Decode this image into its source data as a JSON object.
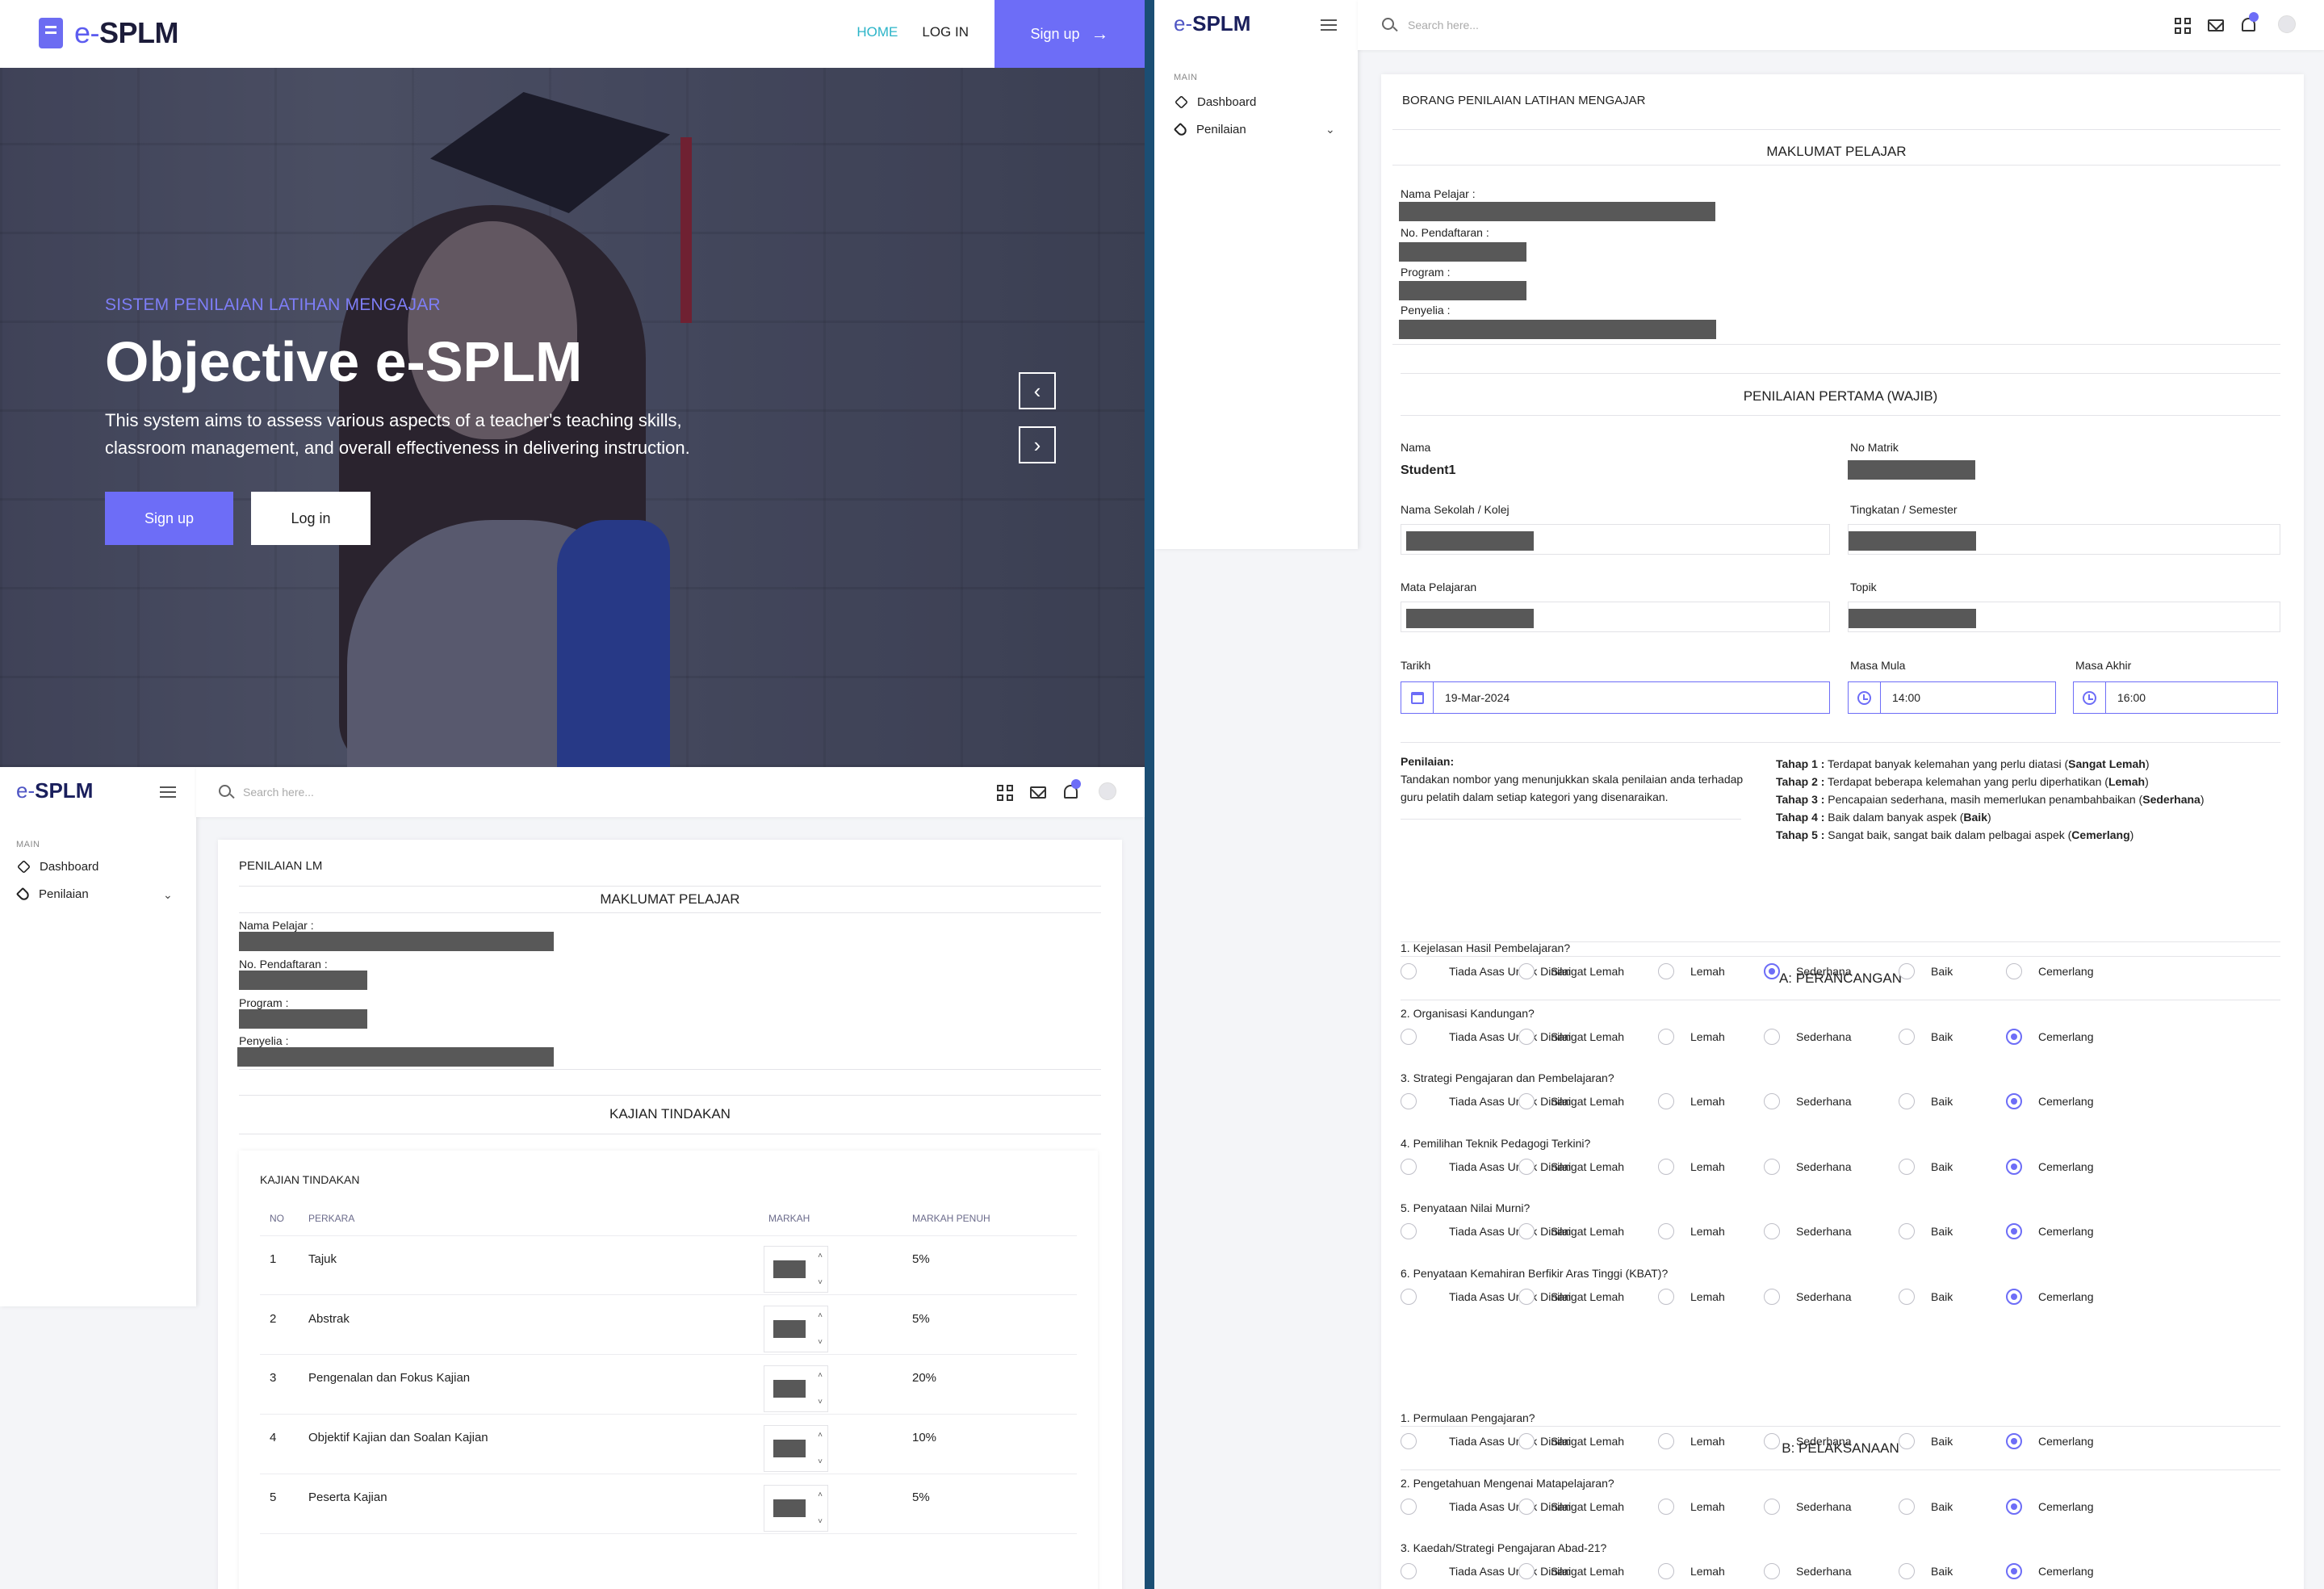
{
  "landing": {
    "brand": "e-SPLM",
    "brand_e": "e-",
    "brand_rest": "SPLM",
    "nav": {
      "home": "HOME",
      "login": "LOG IN",
      "signup": "Sign up"
    },
    "hero": {
      "kicker": "SISTEM PENILAIAN LATIHAN MENGAJAR",
      "title": "Objective e-SPLM",
      "description": "This system aims to assess various aspects of a teacher's teaching skills, classroom management, and overall effectiveness in delivering instruction.",
      "signup": "Sign up",
      "login": "Log in",
      "prev": "‹",
      "next": "›"
    }
  },
  "admin": {
    "brand_e": "e-",
    "brand_rest": "SPLM",
    "search_placeholder": "Search here...",
    "main_label": "MAIN",
    "nav": {
      "dashboard": "Dashboard",
      "penilaian": "Penilaian"
    }
  },
  "lm": {
    "card_title": "PENILAIAN LM",
    "maklumat_title": "MAKLUMAT PELAJAR",
    "fields": {
      "nama": "Nama Pelajar :",
      "no_pendaftaran": "No. Pendaftaran :",
      "program": "Program :",
      "penyelia": "Penyelia :"
    },
    "kajian_section": "KAJIAN TINDAKAN",
    "kajian_subtitle": "KAJIAN TINDAKAN",
    "table": {
      "headers": [
        "NO",
        "PERKARA",
        "MARKAH",
        "MARKAH PENUH"
      ],
      "rows": [
        {
          "no": "1",
          "perkara": "Tajuk",
          "penuh": "5%"
        },
        {
          "no": "2",
          "perkara": "Abstrak",
          "penuh": "5%"
        },
        {
          "no": "3",
          "perkara": "Pengenalan dan Fokus Kajian",
          "penuh": "20%"
        },
        {
          "no": "4",
          "perkara": "Objektif Kajian dan Soalan Kajian",
          "penuh": "10%"
        },
        {
          "no": "5",
          "perkara": "Peserta Kajian",
          "penuh": "5%"
        }
      ]
    }
  },
  "borang": {
    "card_title": "BORANG PENILAIAN LATIHAN MENGAJAR",
    "maklumat_title": "MAKLUMAT PELAJAR",
    "fields": {
      "nama": "Nama Pelajar :",
      "no_pendaftaran": "No. Pendaftaran :",
      "program": "Program :",
      "penyelia": "Penyelia :"
    },
    "pertama_title": "PENILAIAN PERTAMA (WAJIB)",
    "form": {
      "nama_label": "Nama",
      "nama_value": "Student1",
      "no_matrik_label": "No Matrik",
      "sekolah_label": "Nama Sekolah / Kolej",
      "tingkatan_label": "Tingkatan / Semester",
      "mata_label": "Mata Pelajaran",
      "topik_label": "Topik",
      "tarikh_label": "Tarikh",
      "tarikh_value": "19-Mar-2024",
      "masa_mula_label": "Masa Mula",
      "masa_mula_value": "14:00",
      "masa_akhir_label": "Masa Akhir",
      "masa_akhir_value": "16:00"
    },
    "penilaian_note_title": "Penilaian:",
    "penilaian_note": "Tandakan nombor yang menunjukkan skala penilaian anda terhadap guru pelatih dalam setiap kategori yang disenaraikan.",
    "scale": [
      {
        "tahap": "Tahap 1 :",
        "text": " Terdapat banyak kelemahan yang perlu diatasi (",
        "bold": "Sangat Lemah",
        "end": ")"
      },
      {
        "tahap": "Tahap 2 :",
        "text": " Terdapat beberapa kelemahan yang perlu diperhatikan (",
        "bold": "Lemah",
        "end": ")"
      },
      {
        "tahap": "Tahap 3 :",
        "text": " Pencapaian sederhana, masih memerlukan penambahbaikan (",
        "bold": "Sederhana",
        "end": ")"
      },
      {
        "tahap": "Tahap 4 :",
        "text": " Baik dalam banyak aspek (",
        "bold": "Baik",
        "end": ")"
      },
      {
        "tahap": "Tahap 5 :",
        "text": " Sangat baik, sangat baik dalam pelbagai aspek (",
        "bold": "Cemerlang",
        "end": ")"
      }
    ],
    "options": [
      "Tiada Asas Untuk Dinilai",
      "Sangat Lemah",
      "Lemah",
      "Sederhana",
      "Baik",
      "Cemerlang"
    ],
    "section_a": "A: PERANCANGAN",
    "questions_a": [
      {
        "q": "1. Kejelasan Hasil Pembelajaran?",
        "selected": 3
      },
      {
        "q": "2. Organisasi Kandungan?",
        "selected": 5
      },
      {
        "q": "3. Strategi Pengajaran dan Pembelajaran?",
        "selected": 5
      },
      {
        "q": "4. Pemilihan Teknik Pedagogi Terkini?",
        "selected": 5
      },
      {
        "q": "5. Penyataan Nilai Murni?",
        "selected": 5
      },
      {
        "q": "6. Penyataan Kemahiran Berfikir Aras Tinggi (KBAT)?",
        "selected": 5
      }
    ],
    "section_b": "B: PELAKSANAAN",
    "questions_b": [
      {
        "q": "1. Permulaan Pengajaran?",
        "selected": 5
      },
      {
        "q": "2. Pengetahuan Mengenai Matapelajaran?",
        "selected": 5
      },
      {
        "q": "3. Kaedah/Strategi Pengajaran Abad-21?",
        "selected": 5
      }
    ]
  }
}
